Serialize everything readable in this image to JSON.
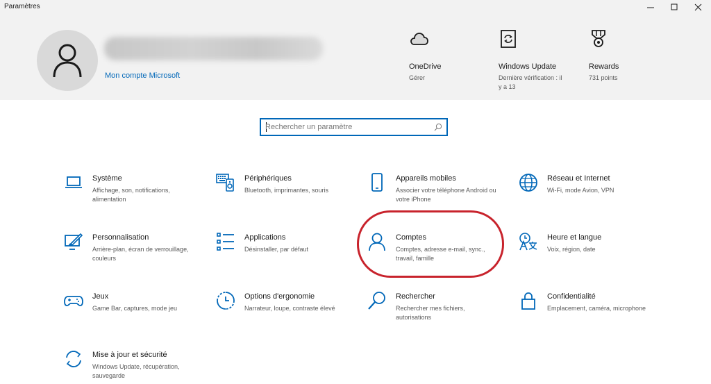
{
  "window": {
    "title": "Paramètres"
  },
  "profile": {
    "account_link": "Mon compte Microsoft"
  },
  "header_items": [
    {
      "name": "OneDrive",
      "sub": "Gérer",
      "icon": "cloud-icon"
    },
    {
      "name": "Windows Update",
      "sub": "Dernière vérification : il y a 13",
      "icon": "windows-update-icon"
    },
    {
      "name": "Rewards",
      "sub": "731 points",
      "icon": "rewards-medal-icon"
    }
  ],
  "search": {
    "placeholder": "Rechercher un paramètre"
  },
  "categories": [
    {
      "name": "Système",
      "desc": "Affichage, son, notifications, alimentation",
      "icon": "laptop-icon"
    },
    {
      "name": "Périphériques",
      "desc": "Bluetooth, imprimantes, souris",
      "icon": "devices-icon"
    },
    {
      "name": "Appareils mobiles",
      "desc": "Associer votre téléphone Android ou votre iPhone",
      "icon": "phone-icon"
    },
    {
      "name": "Réseau et Internet",
      "desc": "Wi-Fi, mode Avion, VPN",
      "icon": "globe-icon"
    },
    {
      "name": "Personnalisation",
      "desc": "Arrière-plan, écran de verrouillage, couleurs",
      "icon": "paint-icon"
    },
    {
      "name": "Applications",
      "desc": "Désinstaller, par défaut",
      "icon": "apps-list-icon"
    },
    {
      "name": "Comptes",
      "desc": "Comptes, adresse e-mail, sync., travail, famille",
      "icon": "person-icon"
    },
    {
      "name": "Heure et langue",
      "desc": "Voix, région, date",
      "icon": "time-language-icon"
    },
    {
      "name": "Jeux",
      "desc": "Game Bar, captures, mode jeu",
      "icon": "gamepad-icon"
    },
    {
      "name": "Options d'ergonomie",
      "desc": "Narrateur, loupe, contraste élevé",
      "icon": "ease-of-access-icon"
    },
    {
      "name": "Rechercher",
      "desc": "Rechercher mes fichiers, autorisations",
      "icon": "search-icon"
    },
    {
      "name": "Confidentialité",
      "desc": "Emplacement, caméra, microphone",
      "icon": "lock-icon"
    },
    {
      "name": "Mise à jour et sécurité",
      "desc": "Windows Update, récupération, sauvegarde",
      "icon": "sync-icon"
    }
  ],
  "colors": {
    "accent": "#0067b8",
    "header_bg": "#f2f2f2",
    "highlight": "#c8232c"
  }
}
